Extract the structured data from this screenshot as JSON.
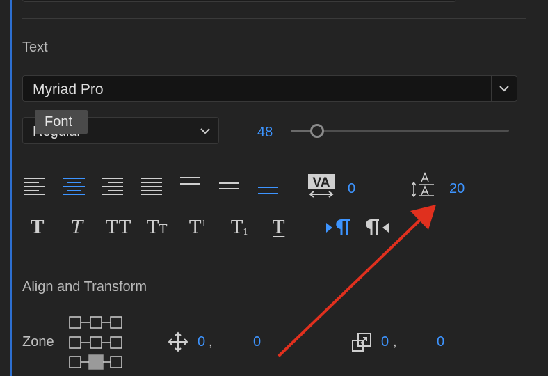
{
  "sections": {
    "text_title": "Text",
    "align_title": "Align and Transform"
  },
  "font": {
    "family_value": "Myriad Pro",
    "style_value": "Regular",
    "size_value": "48",
    "size_slider_fraction": 0.12,
    "tooltip": "Font"
  },
  "paragraph": {
    "kerning_value": "0",
    "leading_value": "20"
  },
  "transform": {
    "zone_label": "Zone",
    "position_x": "0",
    "position_sep": ",",
    "position_y": "0",
    "scale_x": "0",
    "scale_sep": ",",
    "scale_y": "0"
  },
  "styles": {
    "glyph_faux_bold": "T",
    "glyph_faux_italic": "T",
    "glyph_all_caps": "TT",
    "glyph_small_caps_big": "T",
    "glyph_small_caps_small": "T",
    "glyph_superscript": "T",
    "glyph_superscript_mark": "1",
    "glyph_subscript": "T",
    "glyph_subscript_mark": "1",
    "glyph_underline": "T"
  },
  "colors": {
    "accent": "#3d94ff",
    "arrow": "#e0301e",
    "panel_bg": "#232323"
  }
}
